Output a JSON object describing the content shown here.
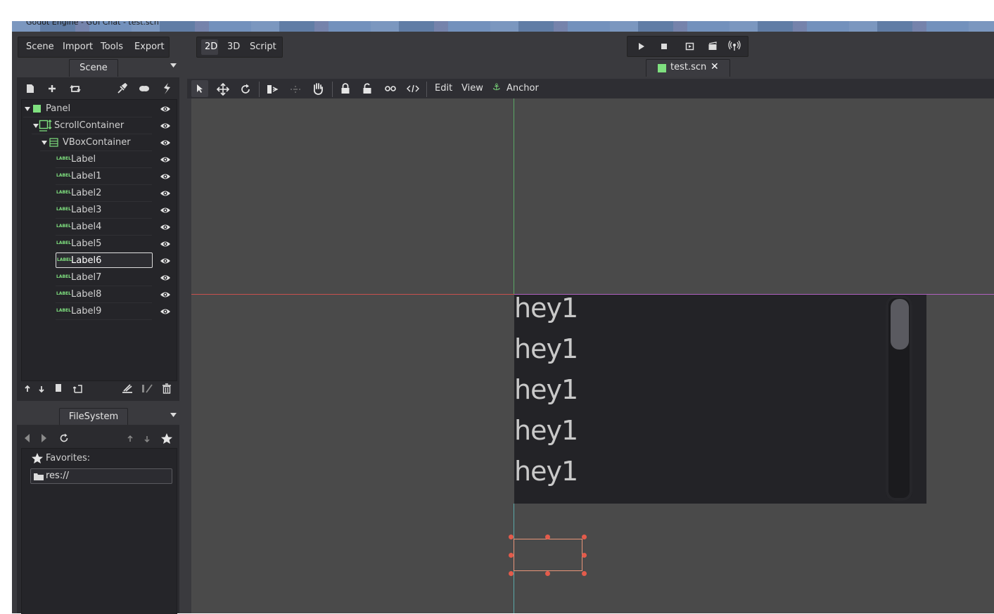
{
  "window": {
    "title": "Godot Engine - GUI Chat - test.scn"
  },
  "menubar": {
    "items": [
      {
        "label": "Scene"
      },
      {
        "label": "Import"
      },
      {
        "label": "Tools"
      },
      {
        "label": "Export"
      }
    ]
  },
  "main_tabs": [
    {
      "label": "2D",
      "active": true
    },
    {
      "label": "3D",
      "active": false
    },
    {
      "label": "Script",
      "active": false
    }
  ],
  "playtest_buttons": [
    "play-icon",
    "stop-icon",
    "play-scene-icon",
    "play-custom-icon",
    "remote-icon"
  ],
  "scene_dock": {
    "tab_label": "Scene",
    "toolbar_icons": [
      "new-node-icon",
      "instance-icon",
      "replace-icon",
      "connect-icon",
      "groups-icon",
      "script-icon"
    ],
    "tree": [
      {
        "label": "Panel",
        "icon": "panel-icon",
        "selected": false
      },
      {
        "label": "ScrollContainer",
        "icon": "scroll-container-icon",
        "selected": false
      },
      {
        "label": "VBoxContainer",
        "icon": "vbox-container-icon",
        "selected": false
      },
      {
        "label": "Label",
        "icon": "label-icon",
        "selected": false
      },
      {
        "label": "Label1",
        "icon": "label-icon",
        "selected": false
      },
      {
        "label": "Label2",
        "icon": "label-icon",
        "selected": false
      },
      {
        "label": "Label3",
        "icon": "label-icon",
        "selected": false
      },
      {
        "label": "Label4",
        "icon": "label-icon",
        "selected": false
      },
      {
        "label": "Label5",
        "icon": "label-icon",
        "selected": false
      },
      {
        "label": "Label6",
        "icon": "label-icon",
        "selected": true
      },
      {
        "label": "Label7",
        "icon": "label-icon",
        "selected": false
      },
      {
        "label": "Label8",
        "icon": "label-icon",
        "selected": false
      },
      {
        "label": "Label9",
        "icon": "label-icon",
        "selected": false
      }
    ],
    "label_icon_text": "LABEL",
    "bottom_icons": [
      "move-up-icon",
      "move-down-icon",
      "duplicate-icon",
      "reparent-icon",
      "merge-icon",
      "edit-script-icon",
      "delete-icon"
    ]
  },
  "filesystem_dock": {
    "tab_label": "FileSystem",
    "favorites_label": "Favorites:",
    "path": "res://"
  },
  "scene_tab": {
    "label": "test.scn",
    "close_glyph": "✕"
  },
  "viewport_toolbar": {
    "menus": [
      {
        "label": "Edit"
      },
      {
        "label": "View"
      },
      {
        "label": "Anchor"
      }
    ],
    "anchor_glyph": "⚓"
  },
  "viewport": {
    "lines": [
      "hey1",
      "hey1",
      "hey1",
      "hey1",
      "hey1"
    ]
  },
  "colors": {
    "selection_outline": "#e8e8e8",
    "origin_x_axis": "#c8504e",
    "origin_y_axis": "#5aa865",
    "handle": "#e35b4b",
    "node_green": "#7fe07f"
  }
}
